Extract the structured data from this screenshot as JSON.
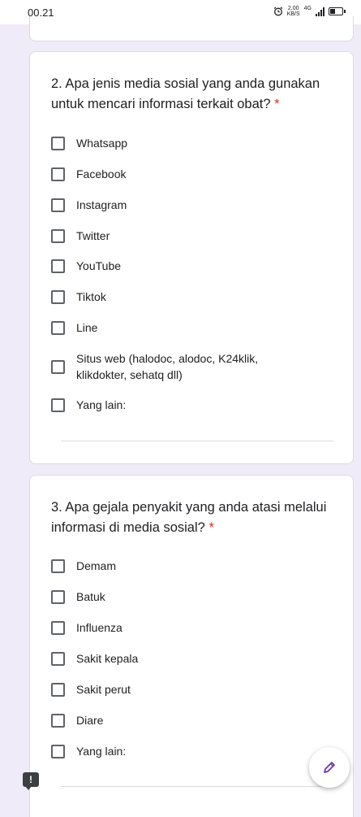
{
  "status_bar": {
    "time": "00.21",
    "net_speed_value": "2,00",
    "net_speed_unit": "KB/S",
    "network": "4G"
  },
  "question2": {
    "title": "2. Apa jenis media sosial yang anda gunakan untuk mencari informasi terkait obat?",
    "required_mark": "*",
    "options": [
      "Whatsapp",
      "Facebook",
      "Instagram",
      "Twitter",
      "YouTube",
      "Tiktok",
      "Line",
      "Situs web (halodoc, alodoc, K24klik, klikdokter, sehatq dll)",
      "Yang lain:"
    ]
  },
  "question3": {
    "title": "3. Apa gejala penyakit yang anda atasi melalui informasi di media sosial?",
    "required_mark": "*",
    "options": [
      "Demam",
      "Batuk",
      "Influenza",
      "Sakit kepala",
      "Sakit perut",
      "Diare",
      "Yang lain:"
    ]
  },
  "colors": {
    "background": "#f0ebf8",
    "required": "#d93025",
    "accent": "#673ab7"
  },
  "icons": {
    "edit": "pencil-icon",
    "feedback": "feedback-icon"
  }
}
